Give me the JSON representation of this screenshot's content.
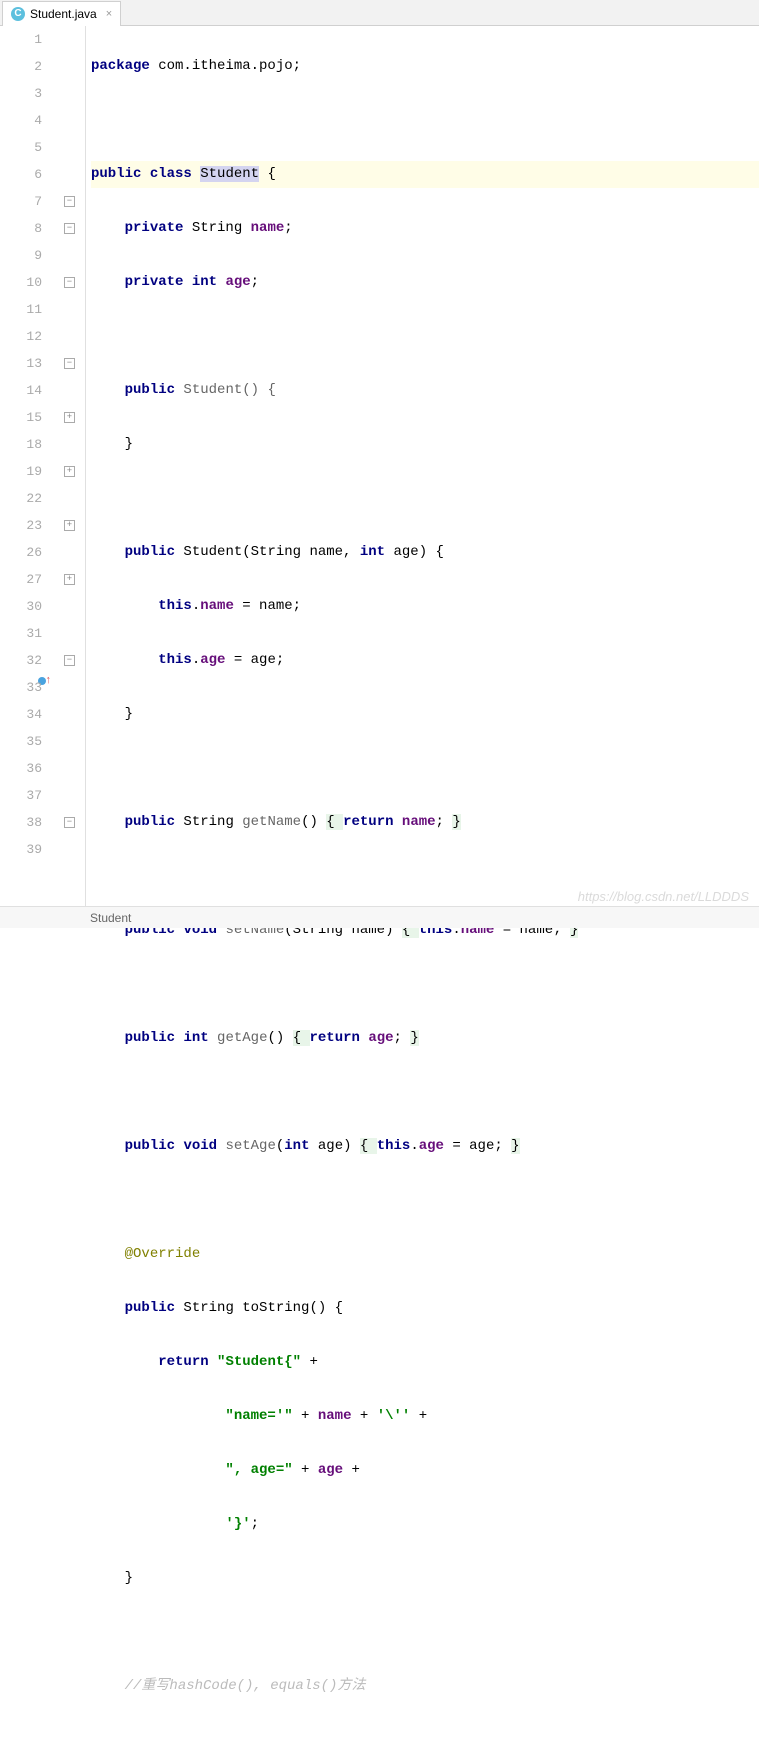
{
  "tab": {
    "filename": "Student.java",
    "icon_letter": "C"
  },
  "gutter_lines": [
    "1",
    "2",
    "3",
    "4",
    "5",
    "6",
    "7",
    "8",
    "9",
    "10",
    "11",
    "12",
    "13",
    "14",
    "15",
    "18",
    "19",
    "22",
    "23",
    "26",
    "27",
    "30",
    "31",
    "32",
    "33",
    "34",
    "35",
    "36",
    "37",
    "38",
    "39"
  ],
  "code": {
    "l1_pkg": "package",
    "l1_rest": " com.itheima.pojo;",
    "l3_pub": "public",
    "l3_cls": "class",
    "l3_name": "Student",
    "l3_brace": " {",
    "l4_priv": "private",
    "l4_type": " String ",
    "l4_fld": "name",
    "l4_end": ";",
    "l5_priv": "private",
    "l5_int": "int",
    "l5_fld": "age",
    "l5_end": ";",
    "l7_pub": "public",
    "l7_ctor": " Student() {",
    "l8": "}",
    "l10_pub": "public",
    "l10_sig": " Student(String name, ",
    "l10_int": "int",
    "l10_rest": " age) {",
    "l11_this": "this",
    "l11_dot": ".",
    "l11_fld": "name",
    "l11_rest": " = name;",
    "l12_this": "this",
    "l12_dot": ".",
    "l12_fld": "age",
    "l12_rest": " = age;",
    "l13": "}",
    "l15_pub": "public",
    "l15_type": " String ",
    "l15_mtd": "getName",
    "l15_p": "() ",
    "l15_b1": "{ ",
    "l15_ret": "return",
    "l15_sp": " ",
    "l15_fld": "name",
    "l15_end": "; ",
    "l15_b2": "}",
    "l19_pub": "public",
    "l19_void": "void",
    "l19_mtd": " setName",
    "l19_p": "(String name) ",
    "l19_b1": "{ ",
    "l19_this": "this",
    "l19_dot": ".",
    "l19_fld": "name",
    "l19_rest": " = name; ",
    "l19_b2": "}",
    "l23_pub": "public",
    "l23_int": "int",
    "l23_mtd": " getAge",
    "l23_p": "() ",
    "l23_b1": "{ ",
    "l23_ret": "return",
    "l23_sp": " ",
    "l23_fld": "age",
    "l23_end": "; ",
    "l23_b2": "}",
    "l27_pub": "public",
    "l27_void": "void",
    "l27_mtd": " setAge",
    "l27_p": "(",
    "l27_int": "int",
    "l27_p2": " age) ",
    "l27_b1": "{ ",
    "l27_this": "this",
    "l27_dot": ".",
    "l27_fld": "age",
    "l27_rest": " = age; ",
    "l27_b2": "}",
    "l31_ann": "@Override",
    "l32_pub": "public",
    "l32_sig": " String toString() {",
    "l33_ret": "return",
    "l33_sp": " ",
    "l33_str": "\"Student{\"",
    "l33_plus": " +",
    "l34_str": "\"name='\"",
    "l34_mid": " + ",
    "l34_fld": "name",
    "l34_mid2": " + ",
    "l34_str2": "'\\''",
    "l34_plus": " +",
    "l35_str": "\", age=\"",
    "l35_mid": " + ",
    "l35_fld": "age",
    "l35_plus": " +",
    "l36_str": "'}'",
    "l36_end": ";",
    "l37": "}",
    "l39_cmt": "//重写hashCode(), equals()方法"
  },
  "breadcrumb": "Student",
  "watermark": "https://blog.csdn.net/LLDDDS"
}
